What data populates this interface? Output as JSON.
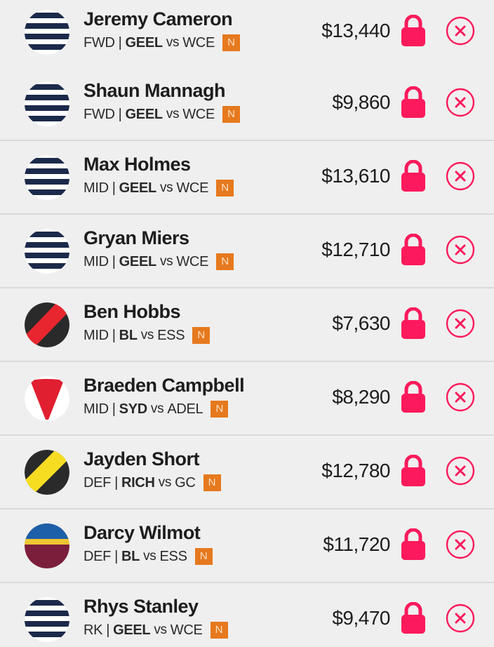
{
  "players": [
    {
      "name": "Jeremy Cameron",
      "position": "FWD",
      "team": "GEEL",
      "vs": "vs",
      "opponent": "WCE",
      "badge": "N",
      "price": "$13,440",
      "logo": "geelong-logo"
    },
    {
      "name": "Shaun Mannagh",
      "position": "FWD",
      "team": "GEEL",
      "vs": "vs",
      "opponent": "WCE",
      "badge": "N",
      "price": "$9,860",
      "logo": "geelong-logo"
    },
    {
      "name": "Max Holmes",
      "position": "MID",
      "team": "GEEL",
      "vs": "vs",
      "opponent": "WCE",
      "badge": "N",
      "price": "$13,610",
      "logo": "geelong-logo"
    },
    {
      "name": "Gryan Miers",
      "position": "MID",
      "team": "GEEL",
      "vs": "vs",
      "opponent": "WCE",
      "badge": "N",
      "price": "$12,710",
      "logo": "geelong-logo"
    },
    {
      "name": "Ben Hobbs",
      "position": "MID",
      "team": "BL",
      "vs": "vs",
      "opponent": "ESS",
      "badge": "N",
      "price": "$7,630",
      "logo": "essendon-logo"
    },
    {
      "name": "Braeden Campbell",
      "position": "MID",
      "team": "SYD",
      "vs": "vs",
      "opponent": "ADEL",
      "badge": "N",
      "price": "$8,290",
      "logo": "sydney-logo"
    },
    {
      "name": "Jayden Short",
      "position": "DEF",
      "team": "RICH",
      "vs": "vs",
      "opponent": "GC",
      "badge": "N",
      "price": "$12,780",
      "logo": "richmond-logo"
    },
    {
      "name": "Darcy Wilmot",
      "position": "DEF",
      "team": "BL",
      "vs": "vs",
      "opponent": "ESS",
      "badge": "N",
      "price": "$11,720",
      "logo": "brisbane-logo"
    },
    {
      "name": "Rhys Stanley",
      "position": "RK",
      "team": "GEEL",
      "vs": "vs",
      "opponent": "WCE",
      "badge": "N",
      "price": "$9,470",
      "logo": "geelong-logo"
    }
  ],
  "colors": {
    "lock": "#fc1a5c",
    "remove": "#fc1a5c",
    "badge": "#e6791e",
    "background": "#efefef",
    "divider": "#dadada"
  },
  "icons": {
    "lock": "lock-icon",
    "remove": "close-circle-icon"
  }
}
